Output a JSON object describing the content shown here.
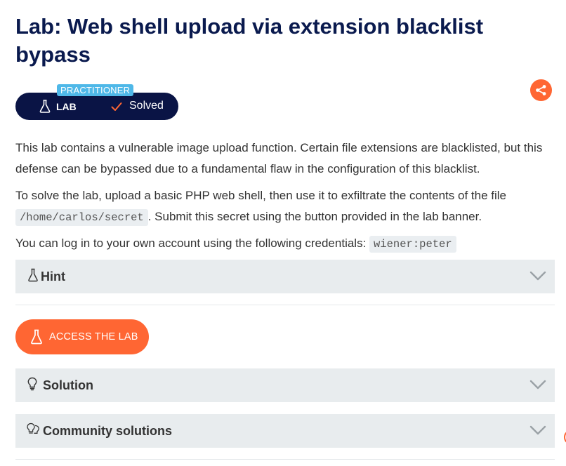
{
  "page": {
    "title": "Lab: Web shell upload via extension blacklist bypass"
  },
  "lab_badge": {
    "level": "PRACTITIONER",
    "type_label": "LAB",
    "status": "Solved"
  },
  "description": {
    "p1": "This lab contains a vulnerable image upload function. Certain file extensions are blacklisted, but this defense can be bypassed due to a fundamental flaw in the configuration of this blacklist.",
    "p2_before": "To solve the lab, upload a basic PHP web shell, then use it to exfiltrate the contents of the file ",
    "p2_code": "/home/carlos/secret",
    "p2_after": ". Submit this secret using the button provided in the lab banner.",
    "p3_before": "You can log in to your own account using the following credentials: ",
    "p3_code": "wiener:peter"
  },
  "sections": {
    "hint": "Hint",
    "access_button": "ACCESS THE LAB",
    "solution": "Solution",
    "community": "Community solutions"
  },
  "icons": {
    "lab": "flask-icon",
    "solved": "checkmark-icon",
    "share": "share-icon",
    "solution": "lightbulb-icon",
    "community": "lightbulbs-icon",
    "expand": "chevron-down-icon"
  },
  "colors": {
    "title": "#0a1a4e",
    "badge_bg": "#0a1445",
    "level_tag": "#4fb8e8",
    "accent": "#ff6633",
    "accordion_bg": "#e8ecee",
    "code_bg": "#eaeef1"
  }
}
